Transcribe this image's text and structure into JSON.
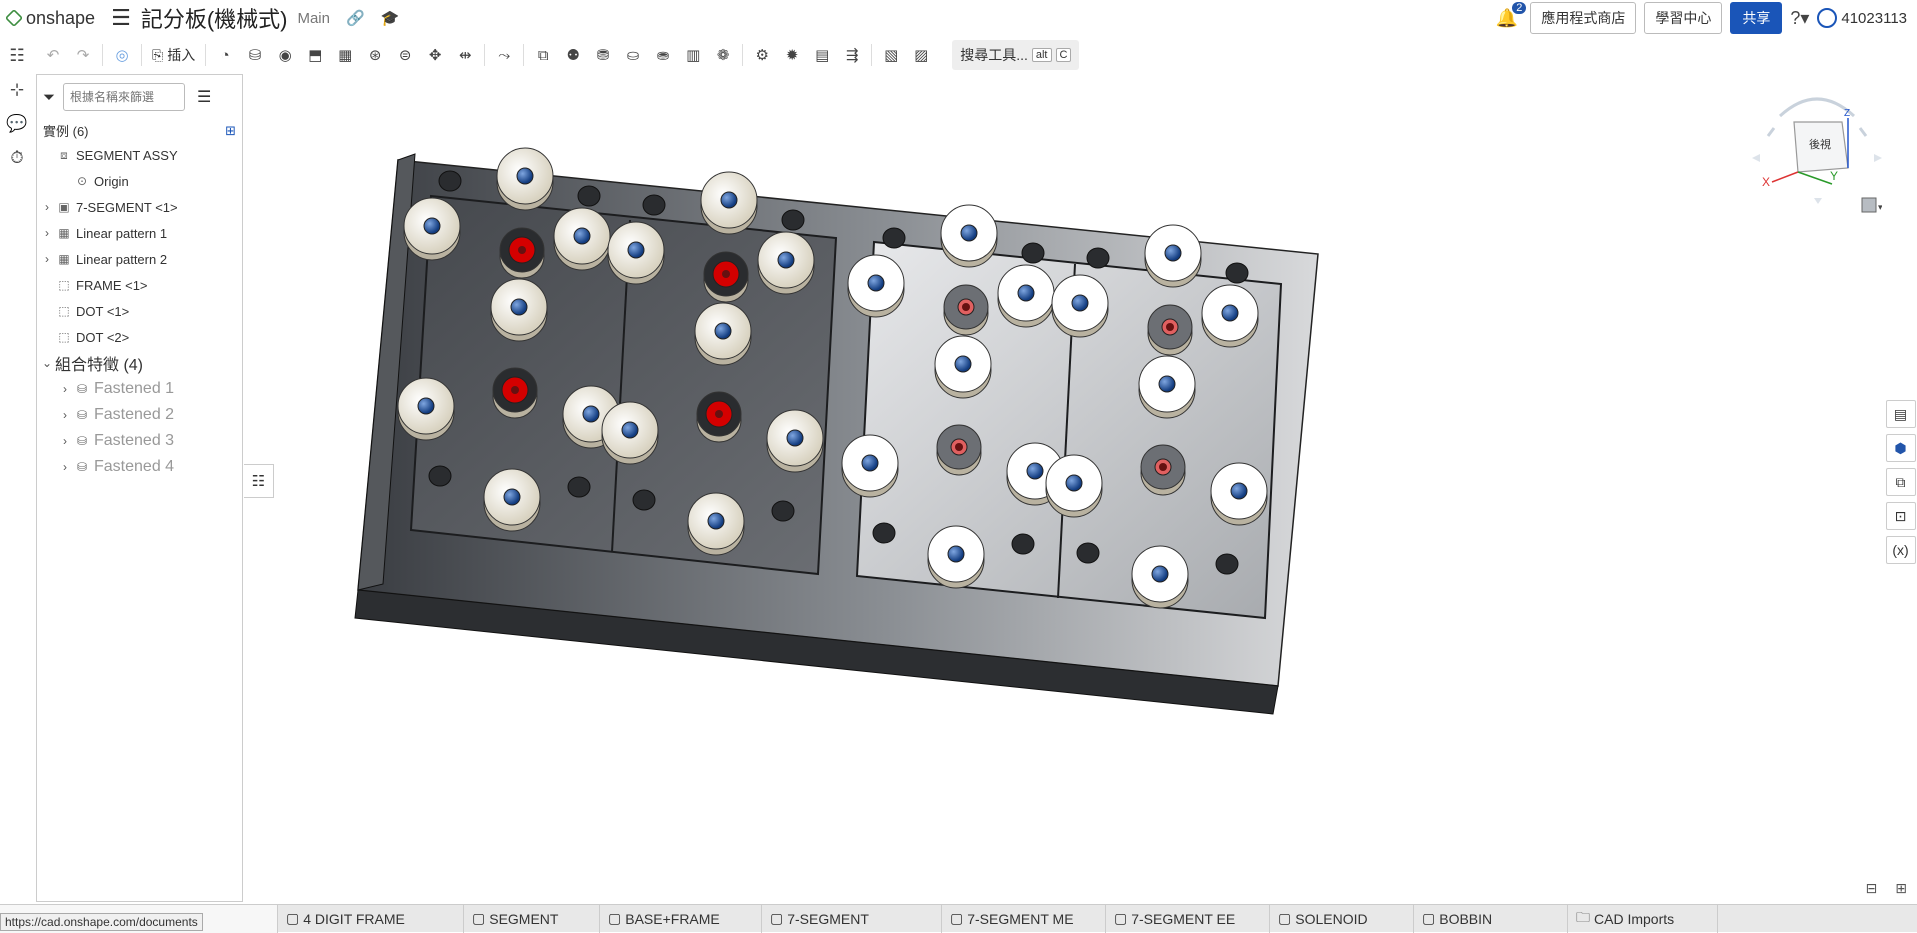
{
  "app": {
    "brand": "onshape",
    "doc_title": "記分板(機械式)",
    "branch": "Main"
  },
  "header": {
    "notifications_count": "2",
    "app_store_label": "應用程式商店",
    "learning_center_label": "學習中心",
    "share_label": "共享",
    "user_name": "41023113"
  },
  "toolbar": {
    "insert_label": "插入",
    "search_tools_label": "搜尋工具...",
    "search_tools_key1": "alt",
    "search_tools_key2": "C"
  },
  "panel": {
    "filter_placeholder": "根據名稱來篩選",
    "instances_header": "實例 (6)",
    "tree": [
      {
        "label": "SEGMENT ASSY",
        "icon": "assembly-icon",
        "chevron": "",
        "indent": 0,
        "dim": false
      },
      {
        "label": "Origin",
        "icon": "origin-icon",
        "chevron": "",
        "indent": 1,
        "dim": false
      },
      {
        "label": "7-SEGMENT <1>",
        "icon": "part-studio-icon",
        "chevron": "›",
        "indent": 0,
        "dim": false
      },
      {
        "label": "Linear pattern 1",
        "icon": "pattern-icon",
        "chevron": "›",
        "indent": 0,
        "dim": false
      },
      {
        "label": "Linear pattern 2",
        "icon": "pattern-icon",
        "chevron": "›",
        "indent": 0,
        "dim": false
      },
      {
        "label": "FRAME <1>",
        "icon": "part-icon",
        "chevron": "",
        "indent": 0,
        "dim": false
      },
      {
        "label": "DOT <1>",
        "icon": "part-icon",
        "chevron": "",
        "indent": 0,
        "dim": false
      },
      {
        "label": "DOT <2>",
        "icon": "part-icon",
        "chevron": "",
        "indent": 0,
        "dim": false
      }
    ],
    "mates_header": "組合特徵 (4)",
    "mates": [
      {
        "label": "Fastened 1"
      },
      {
        "label": "Fastened 2"
      },
      {
        "label": "Fastened 3"
      },
      {
        "label": "Fastened 4"
      }
    ]
  },
  "viewcube": {
    "face_label": "後視",
    "axis_x": "X",
    "axis_y": "Y",
    "axis_z": "Z"
  },
  "tabs": [
    {
      "label": "4 DIGIT FRAME"
    },
    {
      "label": "SEGMENT"
    },
    {
      "label": "BASE+FRAME"
    },
    {
      "label": "7-SEGMENT"
    },
    {
      "label": "7-SEGMENT ME"
    },
    {
      "label": "7-SEGMENT EE"
    },
    {
      "label": "SOLENOID"
    },
    {
      "label": "BOBBIN"
    },
    {
      "label": "CAD Imports"
    }
  ],
  "status_url": "https://cad.onshape.com/documents",
  "colors": {
    "accent": "#1a55b8",
    "brand_green": "#3e8e41",
    "red_dot": "#d40000",
    "pink_dot": "#e06060",
    "blue_dot": "#1f4f9e"
  }
}
